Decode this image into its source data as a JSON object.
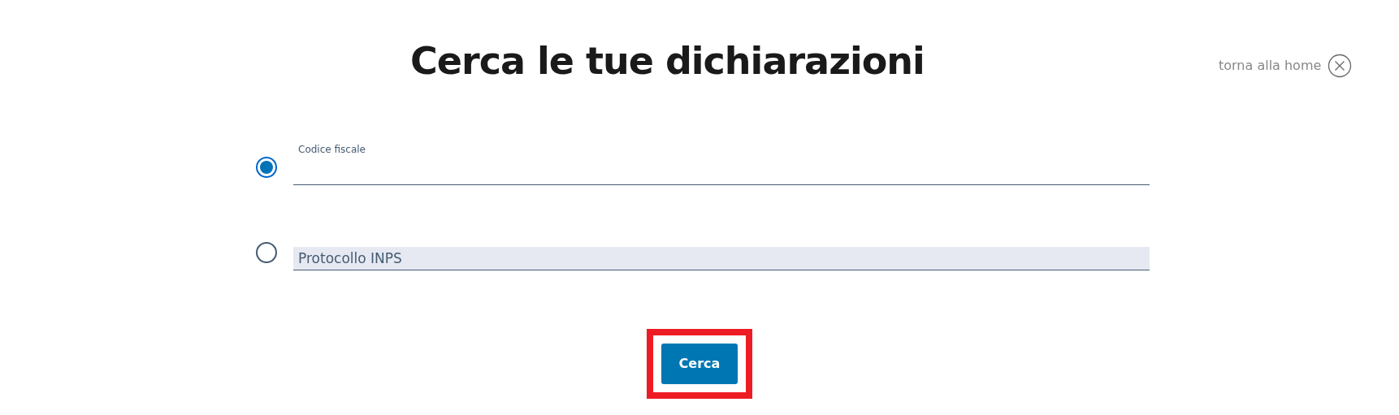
{
  "title": "Cerca le tue dichiarazioni",
  "home_link": {
    "label": "torna alla home"
  },
  "options": [
    {
      "kind": "underlined",
      "label": "Codice fiscale",
      "selected": true
    },
    {
      "kind": "filled",
      "placeholder": "Protocollo INPS",
      "selected": false
    }
  ],
  "search_button": {
    "label": "Cerca",
    "highlighted": true
  }
}
